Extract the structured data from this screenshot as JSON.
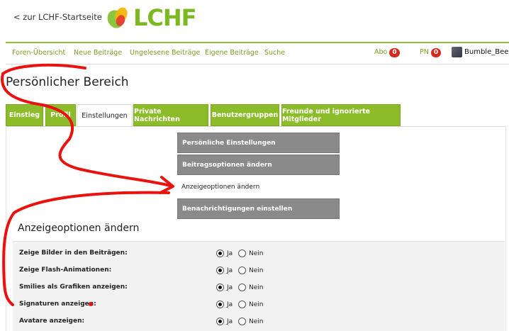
{
  "header": {
    "back_link": "< zur LCHF-Startseite",
    "logo_text": "LCHF",
    "colors": {
      "brand_green": "#7cb81f",
      "badge_red": "#d32b1e",
      "annotation_red": "#e8130f"
    }
  },
  "nav": {
    "items": [
      "Foren-Übersicht",
      "Neue Beiträge",
      "Ungelesene Beiträge",
      "Eigene Beiträge",
      "Suche"
    ],
    "abo_label": "Abo",
    "abo_count": "0",
    "pn_label": "PN",
    "pn_count": "0",
    "username": "Bumble_Bee"
  },
  "page_title": "Persönlicher Bereich",
  "tabs": [
    {
      "label": "Einstieg",
      "active": false
    },
    {
      "label": "Profil",
      "active": false
    },
    {
      "label": "Einstellungen",
      "active": true
    },
    {
      "label": "Private Nachrichten",
      "active": false
    },
    {
      "label": "Benutzergruppen",
      "active": false
    },
    {
      "label": "Freunde und ignorierte Mitglieder",
      "active": false
    }
  ],
  "submenu": [
    {
      "label": "Persönliche Einstellungen",
      "active": false
    },
    {
      "label": "Beitragsoptionen ändern",
      "active": false
    },
    {
      "label": "Anzeigeoptionen ändern",
      "active": true
    },
    {
      "label": "Benachrichtigungen einstellen",
      "active": false
    }
  ],
  "section_title": "Anzeigeoptionen ändern",
  "options": {
    "yes_label": "Ja",
    "no_label": "Nein",
    "rows": [
      {
        "label": "Zeige Bilder in den Beiträgen:",
        "value": "Ja"
      },
      {
        "label": "Zeige Flash-Animationen:",
        "value": "Ja"
      },
      {
        "label": "Smilies als Grafiken anzeigen:",
        "value": "Ja"
      },
      {
        "label": "Signaturen anzeigen:",
        "value": "Ja"
      },
      {
        "label": "Avatare anzeigen:",
        "value": "Ja"
      }
    ]
  }
}
